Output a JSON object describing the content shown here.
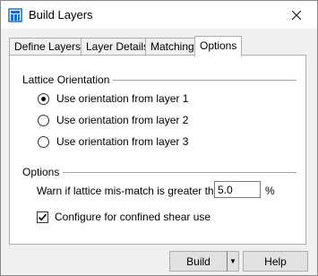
{
  "window": {
    "title": "Build Layers"
  },
  "tabs": [
    {
      "label": "Define Layers"
    },
    {
      "label": "Layer Details"
    },
    {
      "label": "Matching"
    },
    {
      "label": "Options",
      "selected": true
    }
  ],
  "lattice": {
    "group_label": "Lattice Orientation",
    "options": [
      {
        "label": "Use orientation from layer 1",
        "selected": true
      },
      {
        "label": "Use orientation from layer 2",
        "selected": false
      },
      {
        "label": "Use orientation from layer 3",
        "selected": false
      }
    ]
  },
  "options_group": {
    "group_label": "Options",
    "warn_label": "Warn if lattice mis-match is greater than:",
    "warn_value": "5.0",
    "warn_unit": "%",
    "confined_shear_label": "Configure for confined shear use",
    "confined_shear_checked": true
  },
  "buttons": {
    "build": "Build",
    "help": "Help"
  }
}
